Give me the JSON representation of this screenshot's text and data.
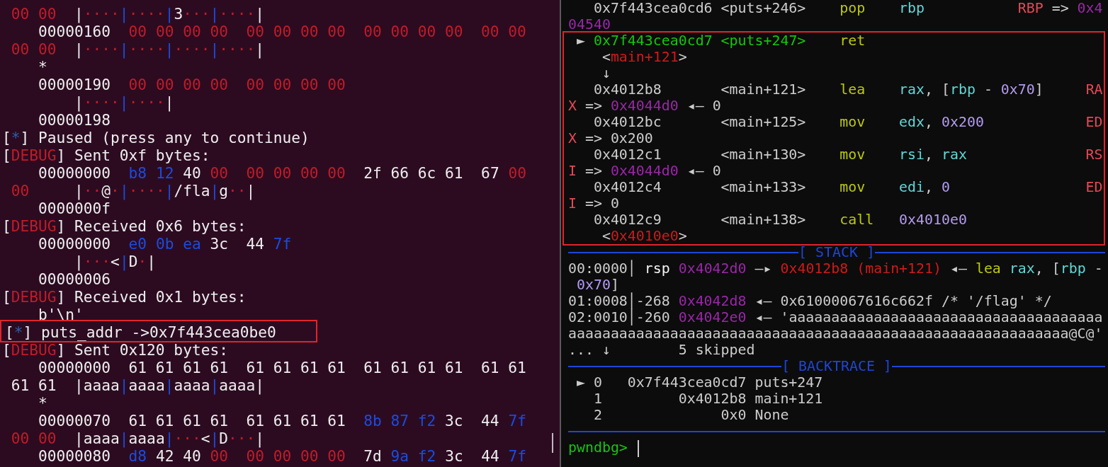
{
  "left_pane": {
    "lines": [
      {
        "kind": "text",
        "segments": [
          {
            "text": " 00 00",
            "color": "#c01c28"
          },
          {
            "text": "  |",
            "color": "#eeeeee"
          },
          {
            "text": "····",
            "color": "#c01c28"
          },
          {
            "text": "|",
            "color": "#1a4ce0"
          },
          {
            "text": "····",
            "color": "#c01c28"
          },
          {
            "text": "|",
            "color": "#1a4ce0"
          },
          {
            "text": "3",
            "color": "#eeeeee"
          },
          {
            "text": "···",
            "color": "#c01c28"
          },
          {
            "text": "|",
            "color": "#1a4ce0"
          },
          {
            "text": "····",
            "color": "#c01c28"
          },
          {
            "text": "|",
            "color": "#eeeeee"
          }
        ]
      },
      {
        "kind": "text",
        "segments": [
          {
            "text": "    00000160  ",
            "color": "#eeeeee"
          },
          {
            "text": "00 00 00 00  00 00 00 00  00 00 00 00  00 00",
            "color": "#c01c28"
          }
        ]
      },
      {
        "kind": "text",
        "segments": [
          {
            "text": " 00 00",
            "color": "#c01c28"
          },
          {
            "text": "  |",
            "color": "#eeeeee"
          },
          {
            "text": "····",
            "color": "#c01c28"
          },
          {
            "text": "|",
            "color": "#1a4ce0"
          },
          {
            "text": "····",
            "color": "#c01c28"
          },
          {
            "text": "|",
            "color": "#1a4ce0"
          },
          {
            "text": "····",
            "color": "#c01c28"
          },
          {
            "text": "|",
            "color": "#1a4ce0"
          },
          {
            "text": "····",
            "color": "#c01c28"
          },
          {
            "text": "|",
            "color": "#eeeeee"
          }
        ]
      },
      {
        "kind": "text",
        "segments": [
          {
            "text": "    *",
            "color": "#eeeeee"
          }
        ]
      },
      {
        "kind": "text",
        "segments": [
          {
            "text": "    00000190  ",
            "color": "#eeeeee"
          },
          {
            "text": "00 00 00 00  00 00 00 00",
            "color": "#c01c28"
          }
        ]
      },
      {
        "kind": "text",
        "segments": [
          {
            "text": "        |",
            "color": "#eeeeee"
          },
          {
            "text": "····",
            "color": "#c01c28"
          },
          {
            "text": "|",
            "color": "#1a4ce0"
          },
          {
            "text": "····",
            "color": "#c01c28"
          },
          {
            "text": "|",
            "color": "#eeeeee"
          }
        ]
      },
      {
        "kind": "text",
        "segments": [
          {
            "text": "    00000198",
            "color": "#eeeeee"
          }
        ]
      },
      {
        "kind": "text",
        "segments": [
          {
            "text": "[",
            "color": "#eeeeee"
          },
          {
            "text": "*",
            "color": "#2a62b0"
          },
          {
            "text": "] Paused (press any to continue)",
            "color": "#eeeeee"
          }
        ]
      },
      {
        "kind": "text",
        "segments": [
          {
            "text": "[",
            "color": "#eeeeee"
          },
          {
            "text": "DEBUG",
            "color": "#c01c28"
          },
          {
            "text": "] Sent 0xf bytes:",
            "color": "#eeeeee"
          }
        ]
      },
      {
        "kind": "text",
        "segments": [
          {
            "text": "    00000000  ",
            "color": "#eeeeee"
          },
          {
            "text": "b8 12",
            "color": "#1a4ce0"
          },
          {
            "text": " 40 ",
            "color": "#eeeeee"
          },
          {
            "text": "00  00 00 00 00",
            "color": "#c01c28"
          },
          {
            "text": "  2f 66 6c 61  67 ",
            "color": "#eeeeee"
          },
          {
            "text": "00",
            "color": "#c01c28"
          }
        ]
      },
      {
        "kind": "text",
        "segments": [
          {
            "text": " 00",
            "color": "#c01c28"
          },
          {
            "text": "     |",
            "color": "#eeeeee"
          },
          {
            "text": "··",
            "color": "#c01c28"
          },
          {
            "text": "@",
            "color": "#eeeeee"
          },
          {
            "text": "·",
            "color": "#c01c28"
          },
          {
            "text": "|",
            "color": "#1a4ce0"
          },
          {
            "text": "····",
            "color": "#c01c28"
          },
          {
            "text": "|",
            "color": "#1a4ce0"
          },
          {
            "text": "/fla",
            "color": "#eeeeee"
          },
          {
            "text": "|",
            "color": "#1a4ce0"
          },
          {
            "text": "g",
            "color": "#eeeeee"
          },
          {
            "text": "··",
            "color": "#c01c28"
          },
          {
            "text": "|",
            "color": "#eeeeee"
          }
        ]
      },
      {
        "kind": "text",
        "segments": [
          {
            "text": "    0000000f",
            "color": "#eeeeee"
          }
        ]
      },
      {
        "kind": "text",
        "segments": [
          {
            "text": "[",
            "color": "#eeeeee"
          },
          {
            "text": "DEBUG",
            "color": "#c01c28"
          },
          {
            "text": "] Received 0x6 bytes:",
            "color": "#eeeeee"
          }
        ]
      },
      {
        "kind": "text",
        "segments": [
          {
            "text": "    00000000  ",
            "color": "#eeeeee"
          },
          {
            "text": "e0 0b ea",
            "color": "#1a4ce0"
          },
          {
            "text": " 3c  44 ",
            "color": "#eeeeee"
          },
          {
            "text": "7f",
            "color": "#1a4ce0"
          }
        ]
      },
      {
        "kind": "text",
        "segments": [
          {
            "text": "        |",
            "color": "#eeeeee"
          },
          {
            "text": "···",
            "color": "#c01c28"
          },
          {
            "text": "<",
            "color": "#eeeeee"
          },
          {
            "text": "|",
            "color": "#1a4ce0"
          },
          {
            "text": "D",
            "color": "#eeeeee"
          },
          {
            "text": "·",
            "color": "#c01c28"
          },
          {
            "text": "|",
            "color": "#eeeeee"
          }
        ]
      },
      {
        "kind": "text",
        "segments": [
          {
            "text": "    00000006",
            "color": "#eeeeee"
          }
        ]
      },
      {
        "kind": "text",
        "segments": [
          {
            "text": "[",
            "color": "#eeeeee"
          },
          {
            "text": "DEBUG",
            "color": "#c01c28"
          },
          {
            "text": "] Received 0x1 bytes:",
            "color": "#eeeeee"
          }
        ]
      },
      {
        "kind": "text",
        "segments": [
          {
            "text": "    b'\\n'",
            "color": "#eeeeee"
          }
        ]
      },
      {
        "kind": "box",
        "lines": [
          {
            "kind": "text",
            "segments": [
              {
                "text": "[",
                "color": "#eeeeee"
              },
              {
                "text": "*",
                "color": "#2a62b0"
              },
              {
                "text": "] puts_addr ->0x7f443cea0be0",
                "color": "#eeeeee"
              }
            ]
          }
        ]
      },
      {
        "kind": "text",
        "segments": [
          {
            "text": "[",
            "color": "#eeeeee"
          },
          {
            "text": "DEBUG",
            "color": "#c01c28"
          },
          {
            "text": "] Sent 0x120 bytes:",
            "color": "#eeeeee"
          }
        ]
      },
      {
        "kind": "text",
        "segments": [
          {
            "text": "    00000000  61 61 61 61  61 61 61 61  61 61 61 61  61 61",
            "color": "#eeeeee"
          }
        ]
      },
      {
        "kind": "text",
        "segments": [
          {
            "text": " 61 61  |aaaa",
            "color": "#eeeeee"
          },
          {
            "text": "|",
            "color": "#1a4ce0"
          },
          {
            "text": "aaaa",
            "color": "#eeeeee"
          },
          {
            "text": "|",
            "color": "#1a4ce0"
          },
          {
            "text": "aaaa",
            "color": "#eeeeee"
          },
          {
            "text": "|",
            "color": "#1a4ce0"
          },
          {
            "text": "aaaa|",
            "color": "#eeeeee"
          }
        ]
      },
      {
        "kind": "text",
        "segments": [
          {
            "text": "    *",
            "color": "#eeeeee"
          }
        ]
      },
      {
        "kind": "text",
        "segments": [
          {
            "text": "    00000070  61 61 61 61  61 61 61 61  ",
            "color": "#eeeeee"
          },
          {
            "text": "8b 87 f2",
            "color": "#1a4ce0"
          },
          {
            "text": " 3c  44 ",
            "color": "#eeeeee"
          },
          {
            "text": "7f",
            "color": "#1a4ce0"
          }
        ]
      },
      {
        "kind": "text",
        "segments": [
          {
            "text": " 00 00",
            "color": "#c01c28"
          },
          {
            "text": "  |aaaa",
            "color": "#eeeeee"
          },
          {
            "text": "|",
            "color": "#1a4ce0"
          },
          {
            "text": "aaaa",
            "color": "#eeeeee"
          },
          {
            "text": "|",
            "color": "#1a4ce0"
          },
          {
            "text": "···",
            "color": "#c01c28"
          },
          {
            "text": "<",
            "color": "#eeeeee"
          },
          {
            "text": "|",
            "color": "#1a4ce0"
          },
          {
            "text": "D",
            "color": "#eeeeee"
          },
          {
            "text": "···",
            "color": "#c01c28"
          },
          {
            "text": "|",
            "color": "#eeeeee"
          }
        ]
      },
      {
        "kind": "text",
        "segments": [
          {
            "text": "    00000080  ",
            "color": "#eeeeee"
          },
          {
            "text": "d8",
            "color": "#1a4ce0"
          },
          {
            "text": " 42 40 ",
            "color": "#eeeeee"
          },
          {
            "text": "00  00 00 00 00",
            "color": "#c01c28"
          },
          {
            "text": "  7d ",
            "color": "#eeeeee"
          },
          {
            "text": "9a f2",
            "color": "#1a4ce0"
          },
          {
            "text": " 3c  44 ",
            "color": "#eeeeee"
          },
          {
            "text": "7f",
            "color": "#1a4ce0"
          }
        ]
      }
    ]
  },
  "right_pane": {
    "lines": [
      {
        "kind": "text",
        "segments": [
          {
            "text": "   0x7f443cea0cd6 <puts+246>    ",
            "color": "#cccccc"
          },
          {
            "text": "pop",
            "color": "#bcc80f"
          },
          {
            "text": "    rbp           ",
            "color": "#61d6d6"
          },
          {
            "text": "RBP",
            "color": "#e74856"
          },
          {
            "text": " => ",
            "color": "#cccccc"
          },
          {
            "text": "0x4",
            "color": "#9a27a8"
          }
        ]
      },
      {
        "kind": "text",
        "segments": [
          {
            "text": "04540",
            "color": "#9a27a8"
          }
        ]
      },
      {
        "kind": "box",
        "lines": [
          {
            "kind": "text",
            "segments": [
              {
                "text": " ►",
                "color": "#cccccc"
              },
              {
                "text": " 0x7f443cea0cd7 <puts+247>    ",
                "color": "#16c60c"
              },
              {
                "text": "ret",
                "color": "#bcc80f"
              }
            ]
          },
          {
            "kind": "text",
            "segments": [
              {
                "text": "    <",
                "color": "#cccccc"
              },
              {
                "text": "main+121",
                "color": "#d01a1a"
              },
              {
                "text": ">",
                "color": "#cccccc"
              }
            ]
          },
          {
            "kind": "text",
            "segments": [
              {
                "text": "    ↓",
                "color": "#cccccc"
              }
            ]
          },
          {
            "kind": "text",
            "segments": [
              {
                "text": "   0x4012b8       <main+121>    ",
                "color": "#cccccc"
              },
              {
                "text": "lea",
                "color": "#bcc80f"
              },
              {
                "text": "    rax",
                "color": "#61d6d6"
              },
              {
                "text": ", [",
                "color": "#cccccc"
              },
              {
                "text": "rbp",
                "color": "#61d6d6"
              },
              {
                "text": " - ",
                "color": "#cccccc"
              },
              {
                "text": "0x70",
                "color": "#b49bf0"
              },
              {
                "text": "]     ",
                "color": "#cccccc"
              },
              {
                "text": "RA",
                "color": "#e74856"
              }
            ]
          },
          {
            "kind": "text",
            "segments": [
              {
                "text": "X",
                "color": "#e74856"
              },
              {
                "text": " => ",
                "color": "#cccccc"
              },
              {
                "text": "0x4044d0",
                "color": "#9a27a8"
              },
              {
                "text": " ◂— 0",
                "color": "#cccccc"
              }
            ]
          },
          {
            "kind": "text",
            "segments": [
              {
                "text": "   0x4012bc       <main+125>    ",
                "color": "#cccccc"
              },
              {
                "text": "mov",
                "color": "#bcc80f"
              },
              {
                "text": "    edx",
                "color": "#61d6d6"
              },
              {
                "text": ", ",
                "color": "#cccccc"
              },
              {
                "text": "0x200            ",
                "color": "#b49bf0"
              },
              {
                "text": "ED",
                "color": "#e74856"
              }
            ]
          },
          {
            "kind": "text",
            "segments": [
              {
                "text": "X",
                "color": "#e74856"
              },
              {
                "text": " => 0x200",
                "color": "#cccccc"
              }
            ]
          },
          {
            "kind": "text",
            "segments": [
              {
                "text": "   0x4012c1       <main+130>    ",
                "color": "#cccccc"
              },
              {
                "text": "mov",
                "color": "#bcc80f"
              },
              {
                "text": "    rsi",
                "color": "#61d6d6"
              },
              {
                "text": ", ",
                "color": "#cccccc"
              },
              {
                "text": "rax              ",
                "color": "#61d6d6"
              },
              {
                "text": "RS",
                "color": "#e74856"
              }
            ]
          },
          {
            "kind": "text",
            "segments": [
              {
                "text": "I",
                "color": "#e74856"
              },
              {
                "text": " => ",
                "color": "#cccccc"
              },
              {
                "text": "0x4044d0",
                "color": "#9a27a8"
              },
              {
                "text": " ◂— 0",
                "color": "#cccccc"
              }
            ]
          },
          {
            "kind": "text",
            "segments": [
              {
                "text": "   0x4012c4       <main+133>    ",
                "color": "#cccccc"
              },
              {
                "text": "mov",
                "color": "#bcc80f"
              },
              {
                "text": "    edi",
                "color": "#61d6d6"
              },
              {
                "text": ", ",
                "color": "#cccccc"
              },
              {
                "text": "0                ",
                "color": "#b49bf0"
              },
              {
                "text": "ED",
                "color": "#e74856"
              }
            ]
          },
          {
            "kind": "text",
            "segments": [
              {
                "text": "I",
                "color": "#e74856"
              },
              {
                "text": " => 0",
                "color": "#cccccc"
              }
            ]
          },
          {
            "kind": "text",
            "segments": [
              {
                "text": "   0x4012c9       <main+138>    ",
                "color": "#cccccc"
              },
              {
                "text": "call",
                "color": "#bcc80f"
              },
              {
                "text": "   0x4010e0",
                "color": "#b49bf0"
              }
            ]
          },
          {
            "kind": "text",
            "segments": [
              {
                "text": "    <",
                "color": "#cccccc"
              },
              {
                "text": "0x4010e0",
                "color": "#d01a1a"
              },
              {
                "text": ">",
                "color": "#cccccc"
              }
            ]
          }
        ]
      },
      {
        "kind": "header",
        "text": "[ STACK ]"
      },
      {
        "kind": "text",
        "segments": [
          {
            "text": "00:0000│",
            "color": "#cccccc"
          },
          {
            "text": " rsp ",
            "color": "#f2f2f2"
          },
          {
            "text": "0x4042d0",
            "color": "#9a27a8"
          },
          {
            "text": " —▸ ",
            "color": "#cccccc"
          },
          {
            "text": "0x4012b8 (main+121)",
            "color": "#d01a1a"
          },
          {
            "text": " ◂— ",
            "color": "#cccccc"
          },
          {
            "text": "lea",
            "color": "#bcc80f"
          },
          {
            "text": " rax",
            "color": "#61d6d6"
          },
          {
            "text": ", [",
            "color": "#cccccc"
          },
          {
            "text": "rbp",
            "color": "#61d6d6"
          },
          {
            "text": " -",
            "color": "#cccccc"
          }
        ]
      },
      {
        "kind": "text",
        "segments": [
          {
            "text": " 0x70",
            "color": "#b49bf0"
          },
          {
            "text": "]",
            "color": "#cccccc"
          }
        ]
      },
      {
        "kind": "text",
        "segments": [
          {
            "text": "01:0008│-268 ",
            "color": "#cccccc"
          },
          {
            "text": "0x4042d8",
            "color": "#9a27a8"
          },
          {
            "text": " ◂— 0x61000067616c662f /* '/flag' */",
            "color": "#cccccc"
          }
        ]
      },
      {
        "kind": "text",
        "segments": [
          {
            "text": "02:0010│-260 ",
            "color": "#cccccc"
          },
          {
            "text": "0x4042e0",
            "color": "#9a27a8"
          },
          {
            "text": " ◂— 'aaaaaaaaaaaaaaaaaaaaaaaaaaaaaaaaaaaaa",
            "color": "#cccccc"
          }
        ]
      },
      {
        "kind": "text",
        "segments": [
          {
            "text": "aaaaaaaaaaaaaaaaaaaaaaaaaaaaaaaaaaaaaaaaaaaaaaaaaaaaaaaaaaa@C@'",
            "color": "#cccccc"
          }
        ]
      },
      {
        "kind": "text",
        "segments": [
          {
            "text": "... ↓        5 skipped",
            "color": "#cccccc"
          }
        ]
      },
      {
        "kind": "header",
        "text": "[ BACKTRACE ]"
      },
      {
        "kind": "text",
        "segments": [
          {
            "text": " ► 0   0x7f443cea0cd7 puts+247",
            "color": "#cccccc"
          }
        ]
      },
      {
        "kind": "text",
        "segments": [
          {
            "text": "   1         0x4012b8 main+121",
            "color": "#cccccc"
          }
        ]
      },
      {
        "kind": "text",
        "segments": [
          {
            "text": "   2              0x0 None",
            "color": "#cccccc"
          }
        ]
      },
      {
        "kind": "rule"
      },
      {
        "kind": "prompt",
        "segments": [
          {
            "text": "pwndbg> ",
            "color": "#16c60c"
          }
        ]
      }
    ]
  }
}
